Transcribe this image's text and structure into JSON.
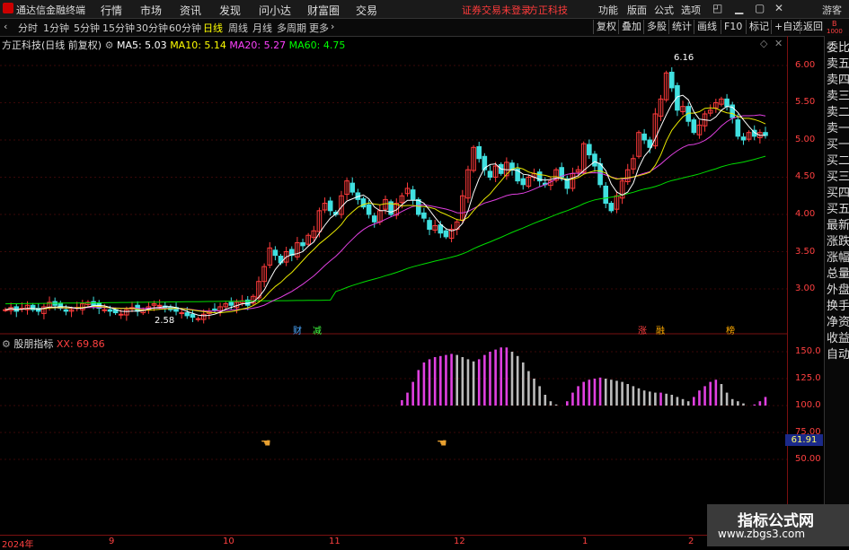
{
  "menubar": {
    "app_title": "通达信金融终端",
    "menus": [
      "行情",
      "市场",
      "资讯",
      "发现",
      "问小达",
      "财富圈",
      "交易"
    ],
    "warning": "证券交易未登录",
    "stock_short": "方正科技",
    "right_menus": [
      "功能",
      "版面",
      "公式",
      "选项"
    ],
    "guest": "游客"
  },
  "toolbar": {
    "periods": [
      "分时",
      "1分钟",
      "5分钟",
      "15分钟",
      "30分钟",
      "60分钟",
      "日线",
      "周线",
      "月线",
      "多周期",
      "更多"
    ],
    "active": "日线",
    "right_buttons": [
      "复权",
      "叠加",
      "多股",
      "统计",
      "画线",
      "F10",
      "标记",
      "+自选",
      "返回"
    ]
  },
  "price_panel": {
    "title": "方正科技(日线 前复权)",
    "ma": [
      {
        "label": "MA5: 5.03",
        "color": "#ffffff"
      },
      {
        "label": "MA10: 5.14",
        "color": "#ffff00"
      },
      {
        "label": "MA20: 5.27",
        "color": "#ff40ff"
      },
      {
        "label": "MA60: 4.75",
        "color": "#00ff00"
      }
    ],
    "y_ticks": [
      "6.00",
      "5.50",
      "5.00",
      "4.50",
      "4.00",
      "3.50",
      "3.00"
    ],
    "high_label": "6.16",
    "low_label": "2.58",
    "markers": [
      {
        "text": "财",
        "color": "#4aa8ff"
      },
      {
        "text": "减",
        "color": "#40ff40"
      },
      {
        "text": "涨",
        "color": "#ff4040"
      },
      {
        "text": "融",
        "color": "#ffaa00"
      },
      {
        "text": "榜",
        "color": "#ffaa00"
      }
    ]
  },
  "indicator_panel": {
    "name": "股朋指标",
    "xx_label": "XX: 69.86",
    "y_ticks": [
      "150.0",
      "125.0",
      "100.0",
      "75.00",
      "50.00"
    ],
    "current_value": "61.91"
  },
  "x_axis": [
    "2024年",
    "9",
    "10",
    "11",
    "12",
    "1",
    "2"
  ],
  "right_panel": [
    "委比",
    "卖五",
    "卖四",
    "卖三",
    "卖二",
    "卖一",
    "买一",
    "买二",
    "买三",
    "买四",
    "买五",
    "最新",
    "涨跌",
    "涨幅",
    "总量",
    "外盘",
    "换手",
    "净资",
    "收益",
    "自动"
  ],
  "right_top": [
    "B",
    "1000"
  ],
  "watermark": {
    "line1": "指标公式网",
    "line2": "www.zbgs3.com"
  },
  "chart_data": [
    {
      "type": "candlestick",
      "ylim": [
        2.6,
        6.2
      ],
      "close": [
        2.72,
        2.75,
        2.7,
        2.74,
        2.78,
        2.72,
        2.7,
        2.76,
        2.82,
        2.78,
        2.74,
        2.7,
        2.72,
        2.75,
        2.8,
        2.82,
        2.78,
        2.74,
        2.72,
        2.7,
        2.68,
        2.66,
        2.72,
        2.75,
        2.7,
        2.72,
        2.76,
        2.8,
        2.78,
        2.75,
        2.72,
        2.7,
        2.68,
        2.64,
        2.62,
        2.6,
        2.66,
        2.7,
        2.72,
        2.76,
        2.8,
        2.78,
        2.82,
        2.84,
        2.78,
        2.9,
        3.1,
        3.3,
        3.55,
        3.45,
        3.35,
        3.5,
        3.45,
        3.62,
        3.58,
        3.72,
        3.78,
        4.05,
        4.15,
        4.05,
        4.0,
        4.25,
        4.45,
        4.3,
        4.2,
        4.1,
        4.0,
        3.9,
        4.05,
        4.2,
        4.0,
        4.15,
        4.25,
        4.35,
        4.2,
        4.0,
        3.95,
        3.8,
        3.85,
        3.75,
        3.7,
        3.8,
        3.9,
        4.25,
        4.6,
        4.9,
        4.75,
        4.6,
        4.5,
        4.65,
        4.55,
        4.7,
        4.6,
        4.45,
        4.4,
        4.5,
        4.55,
        4.45,
        4.4,
        4.45,
        4.6,
        4.5,
        4.35,
        4.55,
        4.6,
        4.95,
        4.8,
        4.65,
        4.4,
        4.15,
        4.05,
        4.25,
        4.45,
        4.6,
        4.75,
        5.1,
        5.0,
        4.9,
        5.35,
        5.55,
        5.9,
        5.7,
        5.4,
        5.45,
        5.25,
        5.1,
        5.2,
        5.35,
        5.4,
        5.5,
        5.55,
        5.45,
        5.3,
        5.05,
        5.0,
        5.1,
        5.05,
        5.1,
        5.06
      ],
      "ma60_end": 4.75
    },
    {
      "type": "bar",
      "series_name": "XX",
      "ylim": [
        25,
        160
      ],
      "values": [
        0,
        0,
        0,
        0,
        0,
        0,
        0,
        0,
        0,
        0,
        0,
        0,
        0,
        0,
        0,
        0,
        0,
        0,
        0,
        0,
        0,
        0,
        0,
        0,
        0,
        0,
        0,
        0,
        0,
        0,
        0,
        0,
        0,
        0,
        0,
        0,
        0,
        0,
        0,
        0,
        0,
        0,
        0,
        0,
        0,
        0,
        0,
        0,
        0,
        0,
        0,
        0,
        0,
        0,
        0,
        0,
        0,
        0,
        0,
        0,
        0,
        0,
        0,
        0,
        0,
        0,
        0,
        0,
        0,
        0,
        0,
        0,
        105,
        112,
        122,
        133,
        140,
        143,
        145,
        146,
        147,
        148,
        147,
        145,
        143,
        141,
        143,
        147,
        150,
        152,
        154,
        154,
        150,
        146,
        140,
        132,
        125,
        118,
        110,
        104,
        101,
        100,
        104,
        112,
        118,
        122,
        124,
        125,
        126,
        125,
        124,
        123,
        122,
        120,
        118,
        116,
        114,
        113,
        112,
        112,
        111,
        110,
        108,
        106,
        104,
        108,
        114,
        118,
        122,
        124,
        120,
        112,
        106,
        104,
        102,
        100,
        101,
        104,
        108,
        112,
        116,
        122,
        128,
        134,
        140,
        144,
        147,
        148,
        145,
        140,
        134,
        127,
        122,
        118,
        115,
        112,
        110,
        108,
        106,
        103,
        101
      ]
    }
  ]
}
